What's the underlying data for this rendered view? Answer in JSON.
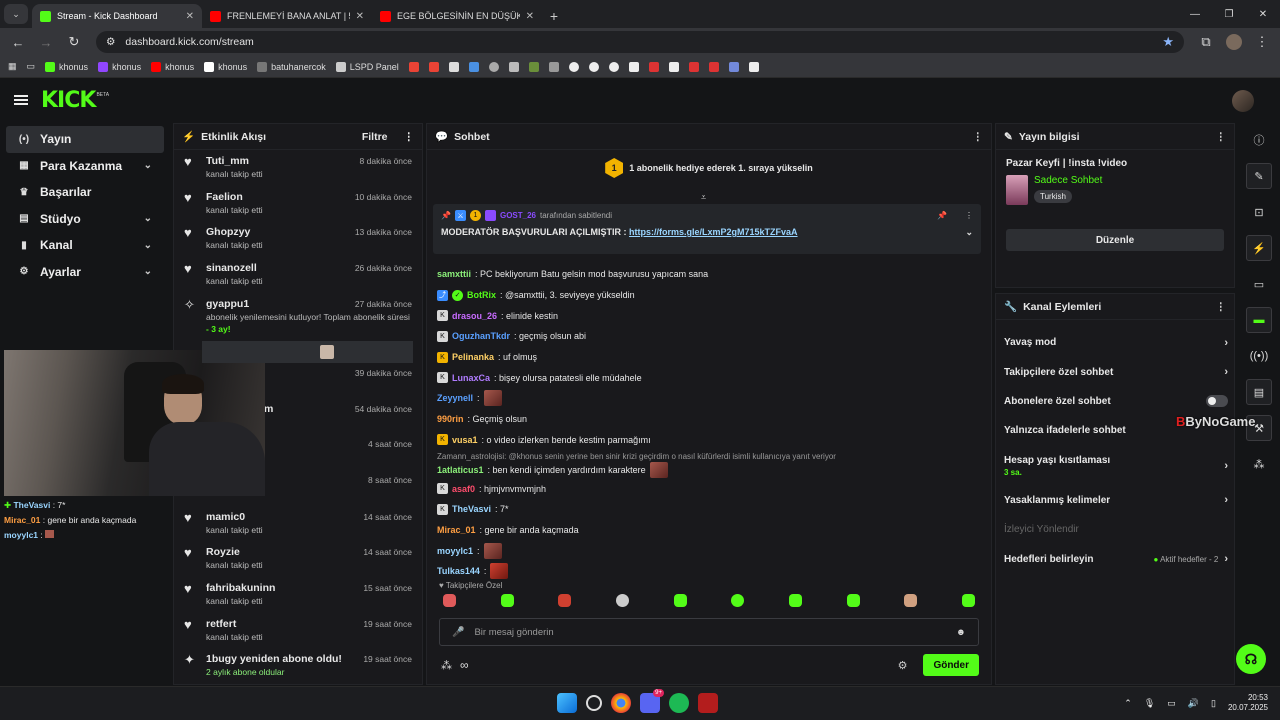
{
  "browser": {
    "tabs": [
      {
        "title": "Stream - Kick Dashboard",
        "color": "#53fc18",
        "active": true
      },
      {
        "title": "FRENLEMEYİ BANA ANLAT | 55",
        "color": "#ff0000",
        "active": false
      },
      {
        "title": "EGE BÖLGESİNİN EN DÜŞÜK P",
        "color": "#ff0000",
        "active": false
      }
    ],
    "new_tab": "+",
    "url": "dashboard.kick.com/stream",
    "bookmarks": [
      {
        "label": "khonus",
        "color": "#53fc18"
      },
      {
        "label": "khonus",
        "color": "#9146ff"
      },
      {
        "label": "khonus",
        "color": "#ff0000"
      },
      {
        "label": "khonus",
        "color": "#ffffff"
      },
      {
        "label": "batuhanercok",
        "color": "#777777"
      },
      {
        "label": "LSPD Panel",
        "color": "#cccccc"
      }
    ]
  },
  "header": {
    "logo": "KICK",
    "beta": "BETA"
  },
  "sidebar": {
    "items": [
      {
        "label": "Yayın",
        "icon": "(•)",
        "chevron": ""
      },
      {
        "label": "Para Kazanma",
        "icon": "▦",
        "chevron": "⌄"
      },
      {
        "label": "Başarılar",
        "icon": "♛",
        "chevron": ""
      },
      {
        "label": "Stüdyo",
        "icon": "▤",
        "chevron": "⌄"
      },
      {
        "label": "Kanal",
        "icon": "▮",
        "chevron": "⌄"
      },
      {
        "label": "Ayarlar",
        "icon": "⚙",
        "chevron": "⌄"
      }
    ]
  },
  "activity": {
    "title": "Etkinlik Akışı",
    "filter": "Filtre",
    "items": [
      {
        "name": "Tuti_mm",
        "time": "8 dakika önce",
        "sub": "kanalı takip etti"
      },
      {
        "name": "Faelion",
        "time": "10 dakika önce",
        "sub": "kanalı takip etti"
      },
      {
        "name": "Ghopzyy",
        "time": "13 dakika önce",
        "sub": "kanalı takip etti"
      },
      {
        "name": "sinanozell",
        "time": "26 dakika önce",
        "sub": "kanalı takip etti"
      },
      {
        "name": "gyappu1",
        "time": "27 dakika önce",
        "sub": "abonelik yenilemesini kutluyor! Toplam abonelik süresi",
        "sub2": "- 3 ay!"
      },
      {
        "name": "",
        "time": "39 dakika önce",
        "sub": ""
      },
      {
        "name": "m",
        "time": "54 dakika önce",
        "sub": ""
      },
      {
        "name": "",
        "time": "4 saat önce",
        "sub": ""
      },
      {
        "name": "",
        "time": "8 saat önce",
        "sub": ""
      },
      {
        "name": "mamic0",
        "time": "14 saat önce",
        "sub": "kanalı takip etti"
      },
      {
        "name": "Royzie",
        "time": "14 saat önce",
        "sub": "kanalı takip etti"
      },
      {
        "name": "fahribakuninn",
        "time": "15 saat önce",
        "sub": "kanalı takip etti"
      },
      {
        "name": "retfert",
        "time": "19 saat önce",
        "sub": "kanalı takip etti"
      },
      {
        "name": "1bugy yeniden abone oldu!",
        "time": "19 saat önce",
        "sub": "2 aylık abone oldular"
      }
    ]
  },
  "overlay_chat": [
    {
      "user": "TheVasvi",
      "text": " : 7*",
      "color": "#9ad5ff"
    },
    {
      "user": "Mirac_01",
      "text": " : gene bir anda kaçmada",
      "color": "#ff9f43"
    },
    {
      "user": "moyylc1",
      "text": " : ",
      "color": "#9ad5ff"
    }
  ],
  "chat": {
    "title": "Sohbet",
    "banner": "1 abonelik hediye ederek 1. sıraya yükselin",
    "banner_badge": "1",
    "pinned": {
      "by": "GOST_26",
      "by_suffix": "tarafından sabitlendi",
      "text": "MODERATÖR BAŞVURULARI AÇILMIŞTIR : ",
      "link": "https://forms.gle/LxmP2gM715kTZFvaA"
    },
    "messages": [
      {
        "user": "samxttii",
        "color": "#8cf07a",
        "text": ": PC bekliyorum Batu gelsin mod başvurusu yapıcam sana",
        "emote": false,
        "badge": ""
      },
      {
        "user": "BotRix",
        "color": "#53fc18",
        "text": ": @samxttii, 3. seviyeye yükseldin",
        "emote": false,
        "badge": "⤴"
      },
      {
        "user": "drasou_26",
        "color": "#c86bff",
        "text": ": elinide kestin",
        "emote": false,
        "badge": "K"
      },
      {
        "user": "OguzhanTkdr",
        "color": "#5aa0ff",
        "text": ": geçmiş olsun abi",
        "emote": false,
        "badge": "K"
      },
      {
        "user": "Pelinanka",
        "color": "#ffd166",
        "text": ": uf olmuş",
        "emote": false,
        "badge": "K"
      },
      {
        "user": "LunaxCa",
        "color": "#b07cff",
        "text": ": bişey olursa patatesli elle müdahele",
        "emote": false,
        "badge": "K"
      },
      {
        "user": "Zeyynell",
        "color": "#5aa0ff",
        "text": ":",
        "emote": true,
        "badge": ""
      },
      {
        "user": "990rin",
        "color": "#ff9f43",
        "text": ": Geçmiş olsun",
        "emote": false,
        "badge": ""
      },
      {
        "user": "vusa1",
        "color": "#ffd166",
        "text": ": o video izlerken bende kestim parmağımı",
        "emote": false,
        "badge": "K"
      },
      {
        "user": "1atlaticus1",
        "color": "#8cf07a",
        "text": ": ben kendi içimden yardırdım karaktere",
        "emote": true,
        "badge": "",
        "reply": "Zamann_astrolojisi: @khonus senin yerine ben sinir krizi geçirdim o nasıl küfürlerdi isimli kullanıcıya yanıt veriyor"
      },
      {
        "user": "asaf0",
        "color": "#ff4d6d",
        "text": ": hjmjvnvmvmjnh",
        "emote": false,
        "badge": "K"
      },
      {
        "user": "TheVasvi",
        "color": "#9ad5ff",
        "text": ": 7*",
        "emote": false,
        "badge": "K"
      },
      {
        "user": "Mirac_01",
        "color": "#ff9f43",
        "text": ": gene bir anda kaçmada",
        "emote": false,
        "badge": ""
      },
      {
        "user": "moyylc1",
        "color": "#9ad5ff",
        "text": ":",
        "emote": true,
        "badge": ""
      },
      {
        "user": "Tulkas144",
        "color": "#9ad5ff",
        "text": ":",
        "emote": true,
        "badge": ""
      }
    ],
    "followers_only": "Takipçilere Özel",
    "placeholder": "Bir mesaj gönderin",
    "send": "Gönder"
  },
  "stream_info": {
    "title": "Yayın bilgisi",
    "stream_title": "Pazar Keyfi | !insta !video",
    "category": "Sadece Sohbet",
    "tag": "Turkish",
    "edit": "Düzenle"
  },
  "channel_actions": {
    "title": "Kanal Eylemleri",
    "items": [
      {
        "label": "Yavaş mod",
        "control": "chevron"
      },
      {
        "label": "Takipçilere özel sohbet",
        "control": "chevron"
      },
      {
        "label": "Abonelere özel sohbet",
        "control": "toggle"
      },
      {
        "label": "Yalnızca ifadelerle sohbet",
        "control": "none"
      },
      {
        "label": "Hesap yaşı kısıtlaması",
        "sub": "3 sa.",
        "control": "chevron"
      },
      {
        "label": "Yasaklanmış kelimeler",
        "control": "chevron"
      },
      {
        "label": "İzleyici Yönlendir",
        "control": "disabled"
      },
      {
        "label": "Hedefleri belirleyin",
        "control": "goals",
        "goal_text": "Aktif hedefler - 2"
      }
    ]
  },
  "watermark": {
    "prefix": "B",
    "text": "ByNoGame"
  },
  "taskbar": {
    "time": "20:53",
    "date": "20.07.2025",
    "discord_badge": "9+"
  }
}
